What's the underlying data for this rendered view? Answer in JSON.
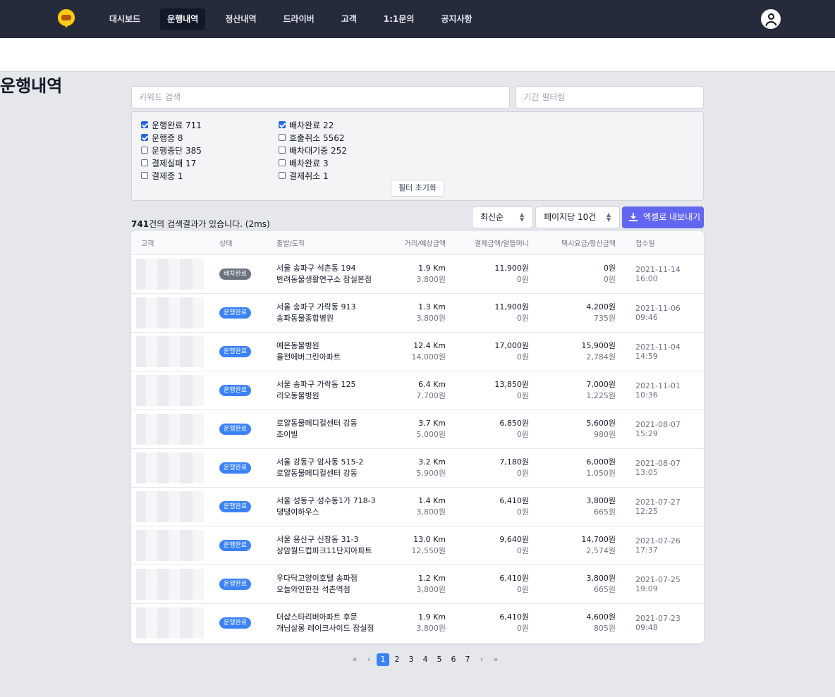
{
  "nav": {
    "items": [
      {
        "label": "대시보드"
      },
      {
        "label": "운행내역"
      },
      {
        "label": "정산내역"
      },
      {
        "label": "드라이버"
      },
      {
        "label": "고객"
      },
      {
        "label": "1:1문의"
      },
      {
        "label": "공지사항"
      }
    ],
    "active_index": 1
  },
  "page": {
    "title": "운행내역"
  },
  "search": {
    "keyword_placeholder": "키워드 검색",
    "period_placeholder": "기간 필터링"
  },
  "filters": {
    "left": [
      {
        "label": "운행완료 711",
        "checked": true
      },
      {
        "label": "운행중 8",
        "checked": true
      },
      {
        "label": "운행중단 385",
        "checked": false
      },
      {
        "label": "결제실패 17",
        "checked": false
      },
      {
        "label": "결제중 1",
        "checked": false
      }
    ],
    "right": [
      {
        "label": "배차완료 22",
        "checked": true
      },
      {
        "label": "호출취소 5562",
        "checked": false
      },
      {
        "label": "배차대기중 252",
        "checked": false
      },
      {
        "label": "배차완료 3",
        "checked": false
      },
      {
        "label": "결제취소 1",
        "checked": false
      }
    ],
    "reset_label": "필터 초기화"
  },
  "results": {
    "count": "741",
    "text": "건의 검색결과가 있습니다. (2ms)"
  },
  "controls": {
    "sort_label": "최신순",
    "perpage_label": "페이지당 10건",
    "export_label": "엑셀로 내보내기"
  },
  "table": {
    "headers": [
      "고객",
      "상태",
      "출발/도착",
      "거리/예상금액",
      "결제금액/알뜰머니",
      "택시요금/정산금액",
      "접수일"
    ],
    "rows": [
      {
        "status": "배차완료",
        "status_color": "gray",
        "origin": "서울 송파구 석촌동 194",
        "dest": "반려동물생활연구소 잠실본점",
        "distance": "1.9 Km",
        "estimate": "3,800원",
        "payment": "11,900원",
        "point": "0원",
        "fare": "0원",
        "settle": "0원",
        "date": "2021-11-14 16:00"
      },
      {
        "status": "운행완료",
        "status_color": "blue",
        "origin": "서울 송파구 가락동 913",
        "dest": "송파동물종합병원",
        "distance": "1.3 Km",
        "estimate": "3,800원",
        "payment": "11,900원",
        "point": "0원",
        "fare": "4,200원",
        "settle": "735원",
        "date": "2021-11-06 09:46"
      },
      {
        "status": "운행완료",
        "status_color": "blue",
        "origin": "예은동물병원",
        "dest": "율전에버그린아파트",
        "distance": "12.4 Km",
        "estimate": "14,000원",
        "payment": "17,000원",
        "point": "0원",
        "fare": "15,900원",
        "settle": "2,784원",
        "date": "2021-11-04 14:59"
      },
      {
        "status": "운행완료",
        "status_color": "blue",
        "origin": "서울 송파구 가락동 125",
        "dest": "리오동물병원",
        "distance": "6.4 Km",
        "estimate": "7,700원",
        "payment": "13,850원",
        "point": "0원",
        "fare": "7,000원",
        "settle": "1,225원",
        "date": "2021-11-01 10:36"
      },
      {
        "status": "운행완료",
        "status_color": "blue",
        "origin": "로얄동물메디컬센터 강동",
        "dest": "조이빌",
        "distance": "3.7 Km",
        "estimate": "5,000원",
        "payment": "6,850원",
        "point": "0원",
        "fare": "5,600원",
        "settle": "980원",
        "date": "2021-08-07 15:29"
      },
      {
        "status": "운행완료",
        "status_color": "blue",
        "origin": "서울 강동구 암사동 515-2",
        "dest": "로얄동물메디컬센터 강동",
        "distance": "3.2 Km",
        "estimate": "5,900원",
        "payment": "7,180원",
        "point": "0원",
        "fare": "6,000원",
        "settle": "1,050원",
        "date": "2021-08-07 13:05"
      },
      {
        "status": "운행완료",
        "status_color": "blue",
        "origin": "서울 성동구 성수동1가 718-3",
        "dest": "댕댕이하우스",
        "distance": "1.4 Km",
        "estimate": "3,800원",
        "payment": "6,410원",
        "point": "0원",
        "fare": "3,800원",
        "settle": "665원",
        "date": "2021-07-27 12:25"
      },
      {
        "status": "운행완료",
        "status_color": "blue",
        "origin": "서울 용산구 신창동 31-3",
        "dest": "상암월드컵파크11단지아파트",
        "distance": "13.0 Km",
        "estimate": "12,550원",
        "payment": "9,640원",
        "point": "0원",
        "fare": "14,700원",
        "settle": "2,574원",
        "date": "2021-07-26 17:37"
      },
      {
        "status": "운행완료",
        "status_color": "blue",
        "origin": "우다닥고양이호텔 송파점",
        "dest": "오늘와인한잔 석촌역점",
        "distance": "1.2 Km",
        "estimate": "3,800원",
        "payment": "6,410원",
        "point": "0원",
        "fare": "3,800원",
        "settle": "665원",
        "date": "2021-07-25 19:09"
      },
      {
        "status": "운행완료",
        "status_color": "blue",
        "origin": "더샵스타리버아파트 후문",
        "dest": "개님살롱 레이크사이드 잠실점",
        "distance": "1.9 Km",
        "estimate": "3,800원",
        "payment": "6,410원",
        "point": "0원",
        "fare": "4,600원",
        "settle": "805원",
        "date": "2021-07-23 09:48"
      }
    ]
  },
  "pagination": {
    "first": "«",
    "prev": "‹",
    "pages": [
      "1",
      "2",
      "3",
      "4",
      "5",
      "6",
      "7"
    ],
    "current": "1",
    "next": "›",
    "last": "»"
  }
}
